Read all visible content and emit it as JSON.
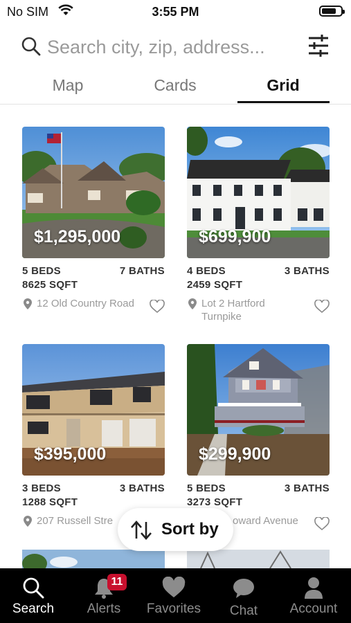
{
  "status_bar": {
    "carrier": "No SIM",
    "time": "3:55 PM"
  },
  "search": {
    "placeholder": "Search city, zip, address..."
  },
  "tabs": [
    {
      "label": "Map",
      "active": false
    },
    {
      "label": "Cards",
      "active": false
    },
    {
      "label": "Grid",
      "active": true
    }
  ],
  "listings": [
    {
      "price": "$1,295,000",
      "beds": "5 BEDS",
      "baths": "7 BATHS",
      "sqft": "8625 SQFT",
      "address": "12 Old Country Road"
    },
    {
      "price": "$699,900",
      "beds": "4 BEDS",
      "baths": "3 BATHS",
      "sqft": "2459 SQFT",
      "address": "Lot 2 Hartford Turnpike"
    },
    {
      "price": "$395,000",
      "beds": "3 BEDS",
      "baths": "3 BATHS",
      "sqft": "1288 SQFT",
      "address": "207 Russell Stre"
    },
    {
      "price": "$299,900",
      "beds": "5 BEDS",
      "baths": "3 BATHS",
      "sqft": "3273 SQFT",
      "address": "oward Avenue"
    }
  ],
  "sort": {
    "label": "Sort by"
  },
  "tab_bar": {
    "items": [
      {
        "label": "Search",
        "icon": "search-icon",
        "active": true
      },
      {
        "label": "Alerts",
        "icon": "bell-icon",
        "badge": "11"
      },
      {
        "label": "Favorites",
        "icon": "heart-icon"
      },
      {
        "label": "Chat",
        "icon": "chat-bubble-icon"
      },
      {
        "label": "Account",
        "icon": "person-icon"
      }
    ]
  },
  "colors": {
    "badge": "#c8102e",
    "tab_bar_bg": "#000000",
    "accent": "#111111"
  }
}
